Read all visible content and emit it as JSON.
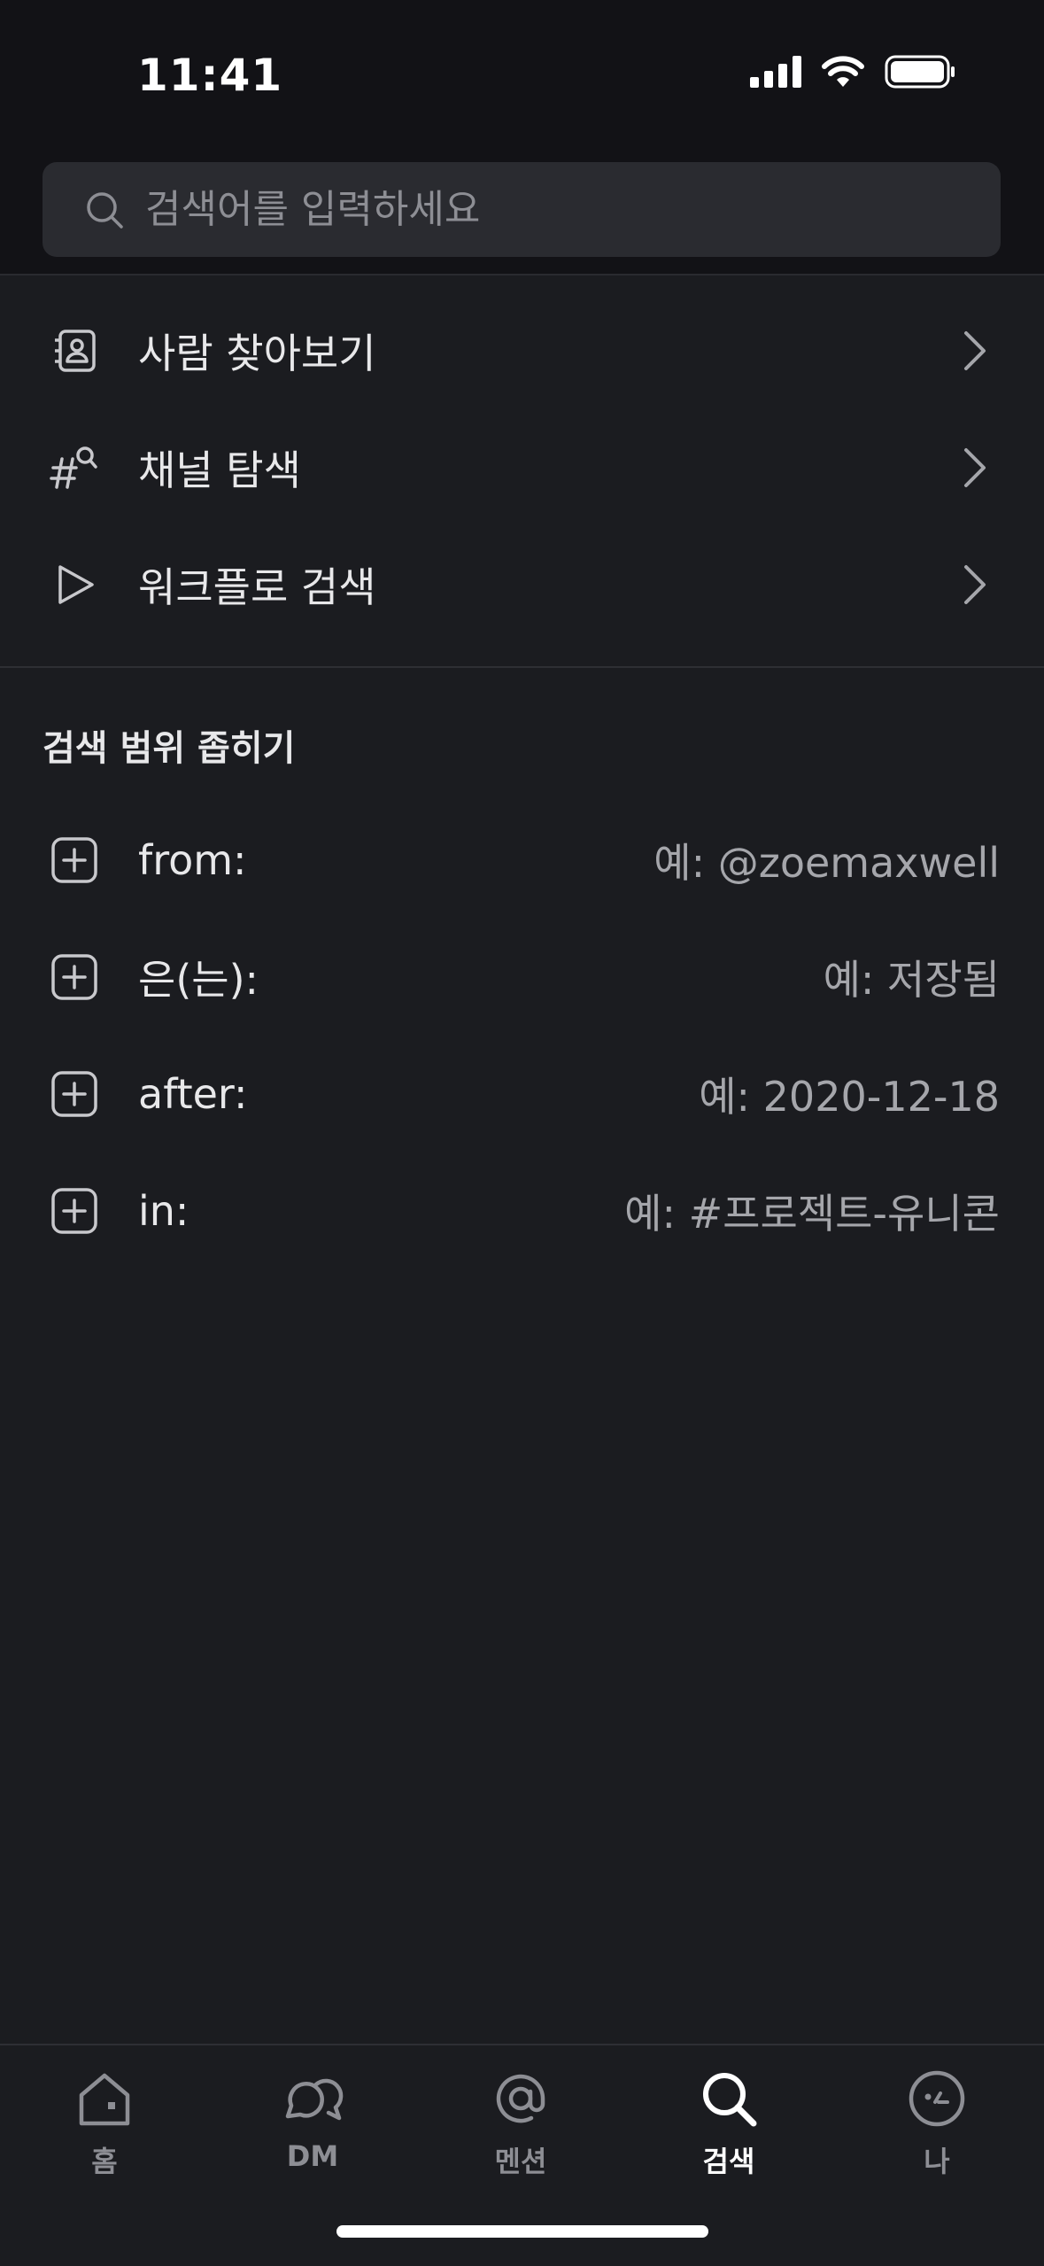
{
  "status_bar": {
    "time": "11:41"
  },
  "search": {
    "placeholder": "검색어를 입력하세요",
    "value": ""
  },
  "nav_items": [
    {
      "label": "사람 찾아보기",
      "icon": "contacts-icon"
    },
    {
      "label": "채널 탐색",
      "icon": "channel-search-icon"
    },
    {
      "label": "워크플로 검색",
      "icon": "play-icon"
    }
  ],
  "narrow_section": {
    "title": "검색 범위 좁히기",
    "filters": [
      {
        "key": "from:",
        "example": "예: @zoemaxwell"
      },
      {
        "key": "은(는):",
        "example": "예: 저장됨"
      },
      {
        "key": "after:",
        "example": "예: 2020-12-18"
      },
      {
        "key": "in:",
        "example": "예: #프로젝트-유니콘"
      }
    ]
  },
  "tabs": [
    {
      "label": "홈",
      "icon": "home-icon",
      "active": false
    },
    {
      "label": "DM",
      "icon": "dm-icon",
      "active": false
    },
    {
      "label": "멘션",
      "icon": "at-icon",
      "active": false
    },
    {
      "label": "검색",
      "icon": "search-icon",
      "active": true
    },
    {
      "label": "나",
      "icon": "profile-icon",
      "active": false
    }
  ],
  "colors": {
    "background": "#1b1c20",
    "header_background": "#121216",
    "search_field": "#2a2b30",
    "text_primary": "#e8e8ea",
    "text_secondary": "#a5a6ab",
    "tab_inactive": "#8d8e94",
    "tab_active": "#ffffff"
  }
}
